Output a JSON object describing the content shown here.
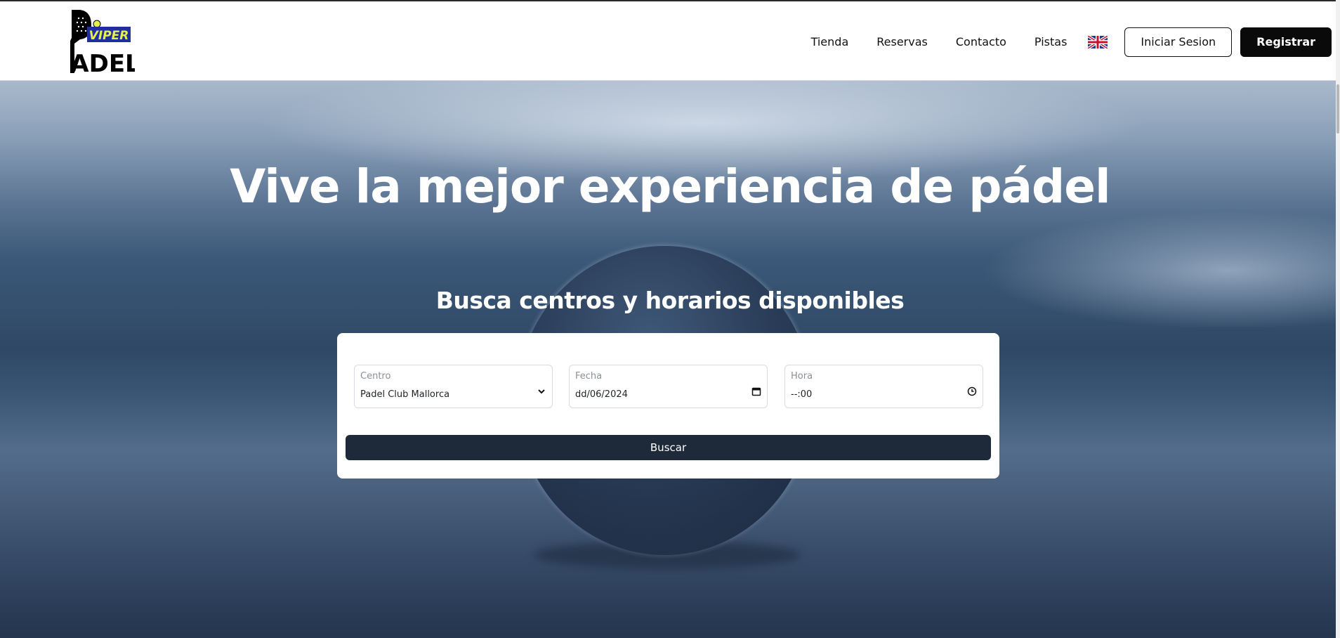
{
  "header": {
    "logo": {
      "text_top": "VIPER",
      "text_bottom": "PADEL"
    },
    "nav": [
      "Tienda",
      "Reservas",
      "Contacto",
      "Pistas"
    ],
    "language_flag": "uk-flag-icon",
    "login_label": "Iniciar Sesion",
    "register_label": "Registrar"
  },
  "hero": {
    "title": "Vive la mejor experiencia de pádel",
    "subtitle": "Busca centros y horarios disponibles"
  },
  "search": {
    "centro": {
      "label": "Centro",
      "value": "Padel Club Mallorca",
      "icon": "chevron-down-icon"
    },
    "fecha": {
      "label": "Fecha",
      "value": "dd/06/2024",
      "icon": "calendar-icon"
    },
    "hora": {
      "label": "Hora",
      "value": "--:00",
      "icon": "clock-icon"
    },
    "button_label": "Buscar"
  },
  "colors": {
    "primary_button": "#0a0a0a",
    "search_button": "#1e2939",
    "logo_yellow": "#e6f04a",
    "logo_blue": "#1f2f9c"
  }
}
